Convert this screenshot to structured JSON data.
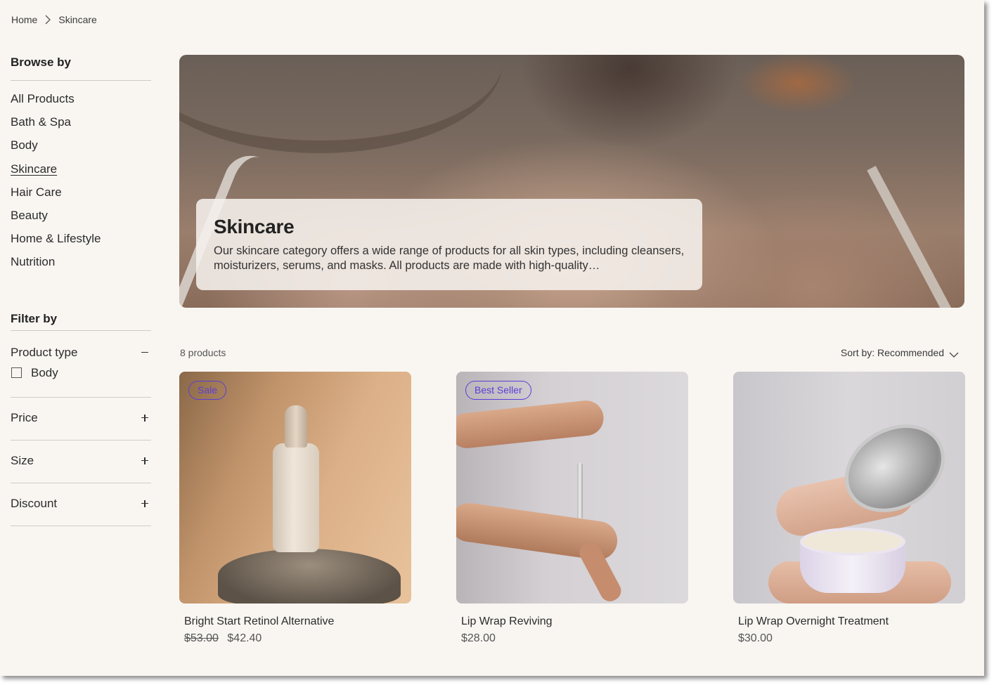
{
  "breadcrumb": {
    "items": [
      {
        "label": "Home"
      },
      {
        "label": "Skincare"
      }
    ]
  },
  "sidebar": {
    "browse_heading": "Browse by",
    "browse_items": [
      {
        "label": "All Products",
        "active": false
      },
      {
        "label": "Bath & Spa",
        "active": false
      },
      {
        "label": "Body",
        "active": false
      },
      {
        "label": "Skincare",
        "active": true
      },
      {
        "label": "Hair Care",
        "active": false
      },
      {
        "label": "Beauty",
        "active": false
      },
      {
        "label": "Home & Lifestyle",
        "active": false
      },
      {
        "label": "Nutrition",
        "active": false
      }
    ],
    "filter_heading": "Filter by",
    "filters": [
      {
        "label": "Product type",
        "expanded": true,
        "icon": "minus-icon",
        "options": [
          {
            "label": "Body",
            "checked": false
          }
        ]
      },
      {
        "label": "Price",
        "expanded": false,
        "icon": "plus-icon"
      },
      {
        "label": "Size",
        "expanded": false,
        "icon": "plus-icon"
      },
      {
        "label": "Discount",
        "expanded": false,
        "icon": "plus-icon"
      }
    ]
  },
  "hero": {
    "title": "Skincare",
    "description": "Our skincare category offers a wide range of products for all skin types, including cleansers, moisturizers, serums, and masks. All products are made with high-quality…"
  },
  "listing": {
    "count_label": "8 products",
    "sort_label": "Sort by: Recommended",
    "products": [
      {
        "name": "Bright Start Retinol Alternative",
        "badge": "Sale",
        "original_price": "$53.00",
        "price": "$42.40"
      },
      {
        "name": "Lip Wrap Reviving",
        "badge": "Best Seller",
        "price": "$28.00"
      },
      {
        "name": "Lip Wrap Overnight Treatment",
        "price": "$30.00"
      }
    ]
  },
  "colors": {
    "background": "#f9f6f2",
    "badge_accent": "#5b3ed6",
    "divider": "#cfcac4"
  }
}
